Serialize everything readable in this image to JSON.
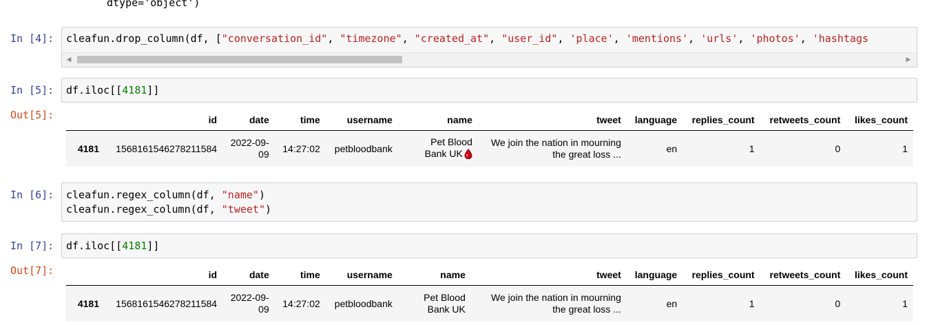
{
  "top_output": "dtype='object')",
  "cells": [
    {
      "in_prompt": "In [4]:",
      "code_tokens": [
        {
          "t": "cleafun.drop_column(df, [",
          "c": ""
        },
        {
          "t": "\"conversation_id\"",
          "c": "str"
        },
        {
          "t": ", ",
          "c": ""
        },
        {
          "t": "\"timezone\"",
          "c": "str"
        },
        {
          "t": ", ",
          "c": ""
        },
        {
          "t": "\"created_at\"",
          "c": "str"
        },
        {
          "t": ", ",
          "c": ""
        },
        {
          "t": "\"user_id\"",
          "c": "str"
        },
        {
          "t": ", ",
          "c": ""
        },
        {
          "t": "'place'",
          "c": "str"
        },
        {
          "t": ", ",
          "c": ""
        },
        {
          "t": "'mentions'",
          "c": "str"
        },
        {
          "t": ", ",
          "c": ""
        },
        {
          "t": "'urls'",
          "c": "str"
        },
        {
          "t": ", ",
          "c": ""
        },
        {
          "t": "'photos'",
          "c": "str"
        },
        {
          "t": ", ",
          "c": ""
        },
        {
          "t": "'hashtags",
          "c": "str"
        }
      ]
    },
    {
      "in_prompt": "In [5]:",
      "code_prefix": "df.iloc[[",
      "code_num": "4181",
      "code_suffix": "]]",
      "out_prompt": "Out[5]:"
    },
    {
      "in_prompt": "In [6]:",
      "line1_prefix": "cleafun.regex_column(df, ",
      "line1_str": "\"name\"",
      "line1_suffix": ")",
      "line2_prefix": "cleafun.regex_column(df, ",
      "line2_str": "\"tweet\"",
      "line2_suffix": ")"
    },
    {
      "in_prompt": "In [7]:",
      "code_prefix": "df.iloc[[",
      "code_num": "4181",
      "code_suffix": "]]",
      "out_prompt": "Out[7]:"
    }
  ],
  "table_columns": [
    "",
    "id",
    "date",
    "time",
    "username",
    "name",
    "tweet",
    "language",
    "replies_count",
    "retweets_count",
    "likes_count"
  ],
  "table1_row": {
    "index": "4181",
    "id": "1568161546278211584",
    "date_line1": "2022-09-",
    "date_line2": "09",
    "time": "14:27:02",
    "username": "petbloodbank",
    "name_line1": "Pet Blood",
    "name_line2": "Bank UK",
    "name_icon": "blood-drop-icon",
    "tweet_line1": "We join the nation in mourning",
    "tweet_line2": "the great loss ...",
    "language": "en",
    "replies_count": "1",
    "retweets_count": "0",
    "likes_count": "1"
  },
  "table2_row": {
    "index": "4181",
    "id": "1568161546278211584",
    "date_line1": "2022-09-",
    "date_line2": "09",
    "time": "14:27:02",
    "username": "petbloodbank",
    "name_line1": "Pet Blood",
    "name_line2": "Bank UK",
    "tweet_line1": "We join the nation in mourning",
    "tweet_line2": "the great loss ...",
    "language": "en",
    "replies_count": "1",
    "retweets_count": "0",
    "likes_count": "1"
  },
  "colors": {
    "prompt_in": "#303f9f",
    "prompt_out": "#d84315",
    "string": "#ba2121",
    "number": "#008000",
    "drop_icon": "#d0021b"
  }
}
